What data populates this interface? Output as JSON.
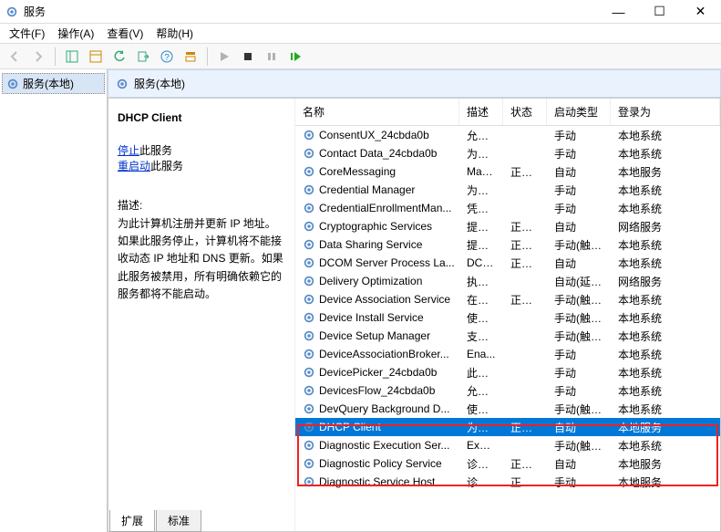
{
  "window": {
    "title": "服务"
  },
  "menu": {
    "file": "文件(F)",
    "action": "操作(A)",
    "view": "查看(V)",
    "help": "帮助(H)"
  },
  "tree": {
    "root": "服务(本地)"
  },
  "header": {
    "title": "服务(本地)"
  },
  "detail": {
    "service_name": "DHCP Client",
    "stop_link": "停止",
    "stop_suffix": "此服务",
    "restart_link": "重启动",
    "restart_suffix": "此服务",
    "desc_heading": "描述:",
    "desc_text": "为此计算机注册并更新 IP 地址。如果此服务停止，计算机将不能接收动态 IP 地址和 DNS 更新。如果此服务被禁用，所有明确依赖它的服务都将不能启动。"
  },
  "columns": {
    "name": "名称",
    "desc": "描述",
    "status": "状态",
    "start": "启动类型",
    "logon": "登录为"
  },
  "rows": [
    {
      "name": "ConsentUX_24cbda0b",
      "desc": "允许...",
      "status": "",
      "start": "手动",
      "logon": "本地系统"
    },
    {
      "name": "Contact Data_24cbda0b",
      "desc": "为联...",
      "status": "",
      "start": "手动",
      "logon": "本地系统"
    },
    {
      "name": "CoreMessaging",
      "desc": "Man...",
      "status": "正在...",
      "start": "自动",
      "logon": "本地服务"
    },
    {
      "name": "Credential Manager",
      "desc": "为用...",
      "status": "",
      "start": "手动",
      "logon": "本地系统"
    },
    {
      "name": "CredentialEnrollmentMan...",
      "desc": "凭据...",
      "status": "",
      "start": "手动",
      "logon": "本地系统"
    },
    {
      "name": "Cryptographic Services",
      "desc": "提供...",
      "status": "正在...",
      "start": "自动",
      "logon": "网络服务"
    },
    {
      "name": "Data Sharing Service",
      "desc": "提供...",
      "status": "正在...",
      "start": "手动(触发...",
      "logon": "本地系统"
    },
    {
      "name": "DCOM Server Process La...",
      "desc": "DCO...",
      "status": "正在...",
      "start": "自动",
      "logon": "本地系统"
    },
    {
      "name": "Delivery Optimization",
      "desc": "执行...",
      "status": "",
      "start": "自动(延迟...",
      "logon": "网络服务"
    },
    {
      "name": "Device Association Service",
      "desc": "在系...",
      "status": "正在...",
      "start": "手动(触发...",
      "logon": "本地系统"
    },
    {
      "name": "Device Install Service",
      "desc": "使计...",
      "status": "",
      "start": "手动(触发...",
      "logon": "本地系统"
    },
    {
      "name": "Device Setup Manager",
      "desc": "支持...",
      "status": "",
      "start": "手动(触发...",
      "logon": "本地系统"
    },
    {
      "name": "DeviceAssociationBroker...",
      "desc": "Ena...",
      "status": "",
      "start": "手动",
      "logon": "本地系统"
    },
    {
      "name": "DevicePicker_24cbda0b",
      "desc": "此用...",
      "status": "",
      "start": "手动",
      "logon": "本地系统"
    },
    {
      "name": "DevicesFlow_24cbda0b",
      "desc": "允许...",
      "status": "",
      "start": "手动",
      "logon": "本地系统"
    },
    {
      "name": "DevQuery Background D...",
      "desc": "使应...",
      "status": "",
      "start": "手动(触发...",
      "logon": "本地系统"
    },
    {
      "name": "DHCP Client",
      "desc": "为此...",
      "status": "正在...",
      "start": "自动",
      "logon": "本地服务",
      "selected": true
    },
    {
      "name": "Diagnostic Execution Ser...",
      "desc": "Exec...",
      "status": "",
      "start": "手动(触发...",
      "logon": "本地系统"
    },
    {
      "name": "Diagnostic Policy Service",
      "desc": "诊断...",
      "status": "正在...",
      "start": "自动",
      "logon": "本地服务"
    },
    {
      "name": "Diagnostic Service Host",
      "desc": "诊断...",
      "status": "正在...",
      "start": "手动",
      "logon": "本地服务"
    }
  ],
  "tabs": {
    "extended": "扩展",
    "standard": "标准"
  },
  "icons": {
    "gear": "gear-icon",
    "back": "←",
    "fwd": "→"
  }
}
